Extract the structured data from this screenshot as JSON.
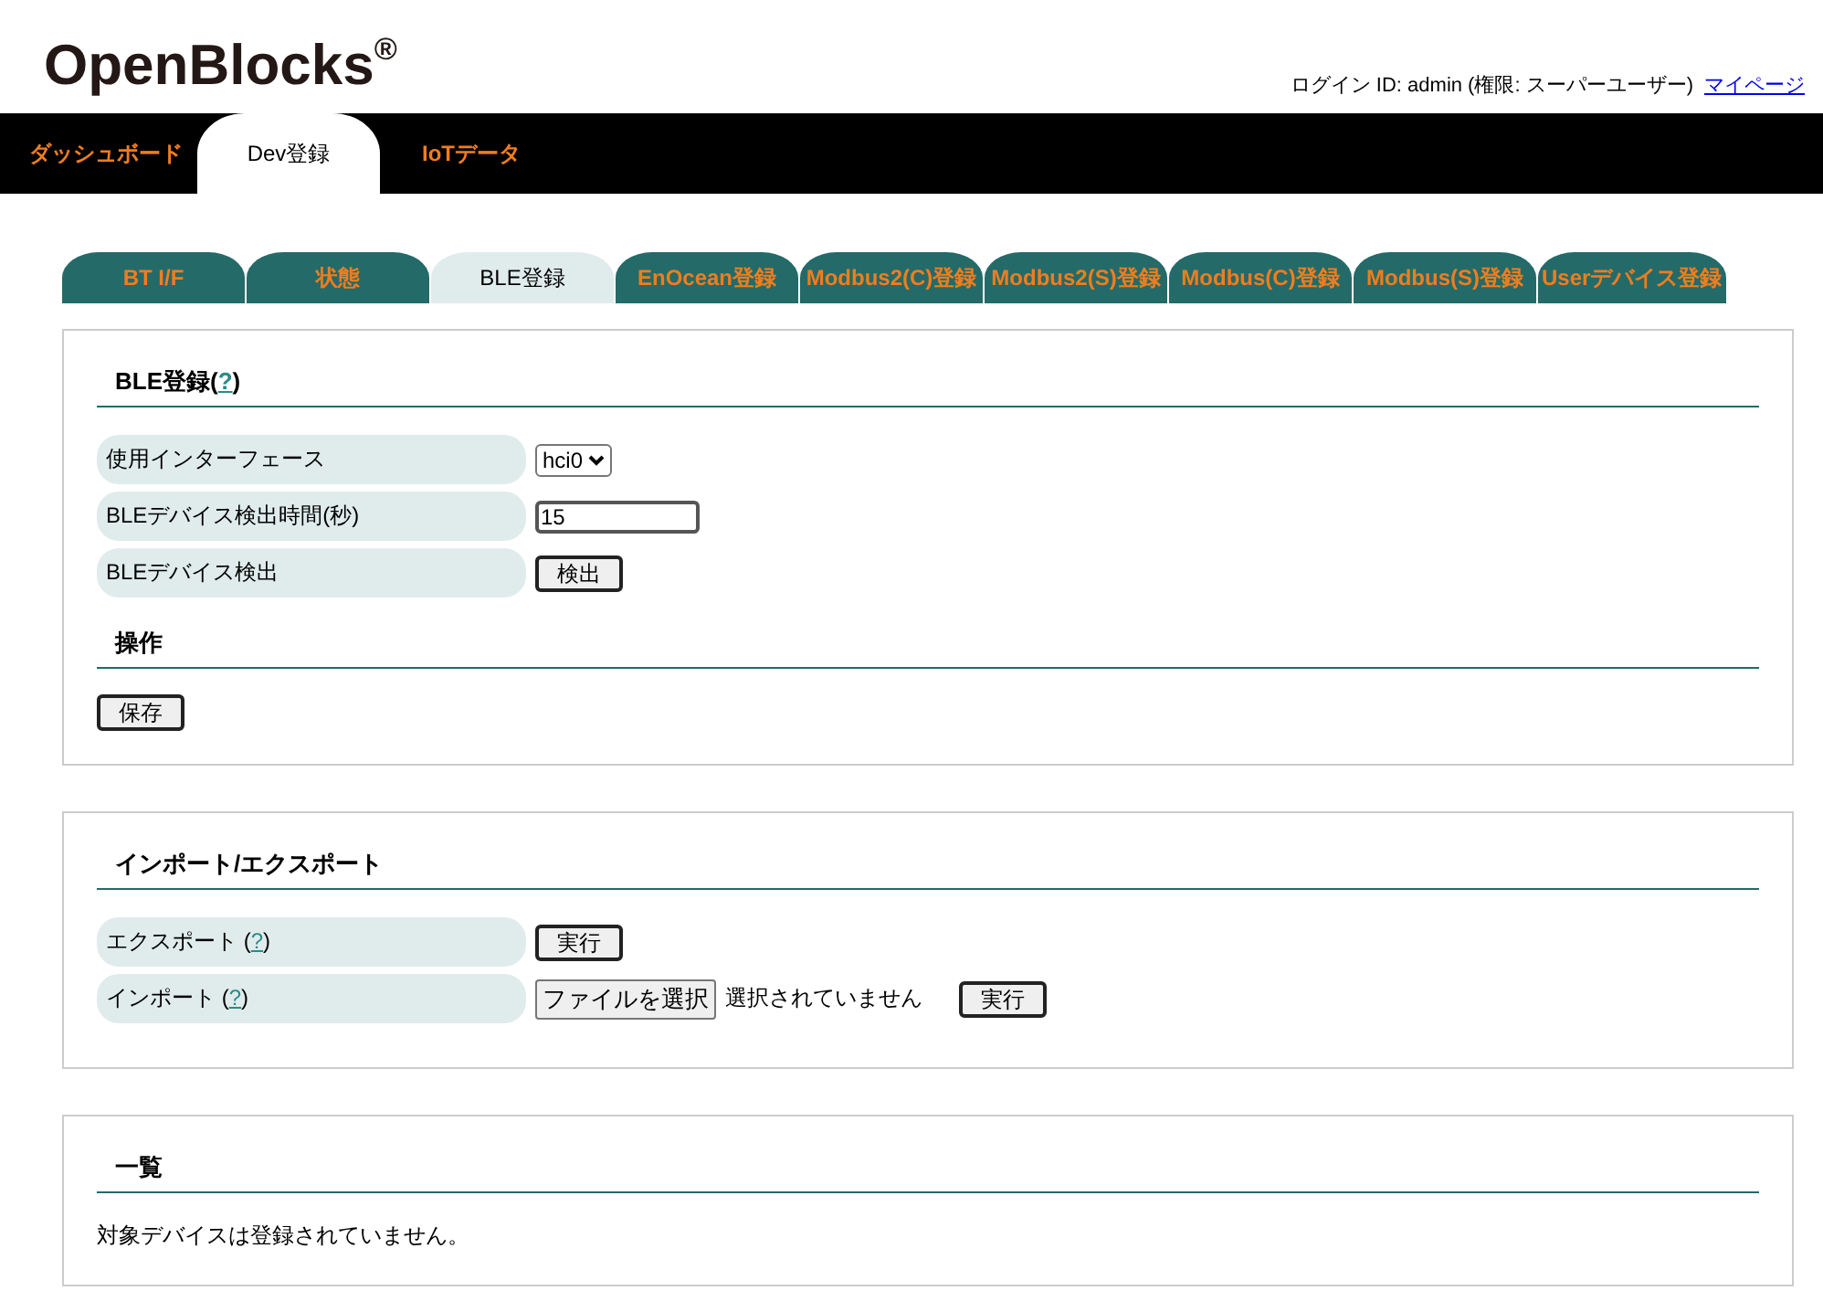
{
  "header": {
    "logo": "OpenBlocks$^{®}$",
    "user_info": "ログイン ID: admin (権限: スーパーユーザー)",
    "links": [
      "マイページ"
    ]
  },
  "main_tabs": [
    {
      "label": "ダッシュボード",
      "selected": false
    },
    {
      "label": "Dev登録",
      "selected": true
    },
    {
      "label": "IoTデータ",
      "selected": false
    }
  ],
  "sub_tabs": [
    {
      "label": "BT I/F",
      "selected": false
    },
    {
      "label": "状態",
      "selected": false
    },
    {
      "label": "BLE登録",
      "selected": true
    },
    {
      "label": "EnOcean登録",
      "selected": false
    },
    {
      "label": "Modbus2(C)登録",
      "selected": false
    },
    {
      "label": "Modbus2(S)登録",
      "selected": false
    },
    {
      "label": "Modbus(C)登録",
      "selected": false
    },
    {
      "label": "Modbus(S)登録",
      "selected": false
    },
    {
      "label": "Userデバイス登録",
      "selected": false
    }
  ],
  "panels": [
    {
      "sections": [
        {
          "title": "BLE登録(",
          "help_link": "?",
          "title_end": ")",
          "rows": [
            {
              "label": "使用インターフェース",
              "controls": [
                {
                  "kind": "select",
                  "value": "hci0"
                }
              ]
            },
            {
              "label": "BLEデバイス検出時間(秒)",
              "controls": [
                {
                  "kind": "text",
                  "value": "15"
                }
              ]
            },
            {
              "label": "BLEデバイス検出",
              "controls": [
                {
                  "kind": "button",
                  "label": "検出"
                }
              ]
            }
          ]
        },
        {
          "title": "操作",
          "buttons": [
            "保存"
          ]
        }
      ]
    },
    {
      "sections": [
        {
          "title": "インポート/エクスポート",
          "rows": [
            {
              "label": "エクスポート (",
              "help_link": "?",
              "label_end": ")",
              "controls": [
                {
                  "kind": "button",
                  "label": "実行"
                }
              ]
            },
            {
              "label": "インポート (",
              "help_link": "?",
              "label_end": ")",
              "controls": [
                {
                  "kind": "file",
                  "label": "ファイルを選択",
                  "status": "選択されていません"
                },
                {
                  "kind": "button",
                  "label": "実行"
                }
              ]
            }
          ]
        }
      ]
    },
    {
      "sections": [
        {
          "title": "一覧",
          "message": "対象デバイスは登録されていません。"
        }
      ]
    }
  ]
}
